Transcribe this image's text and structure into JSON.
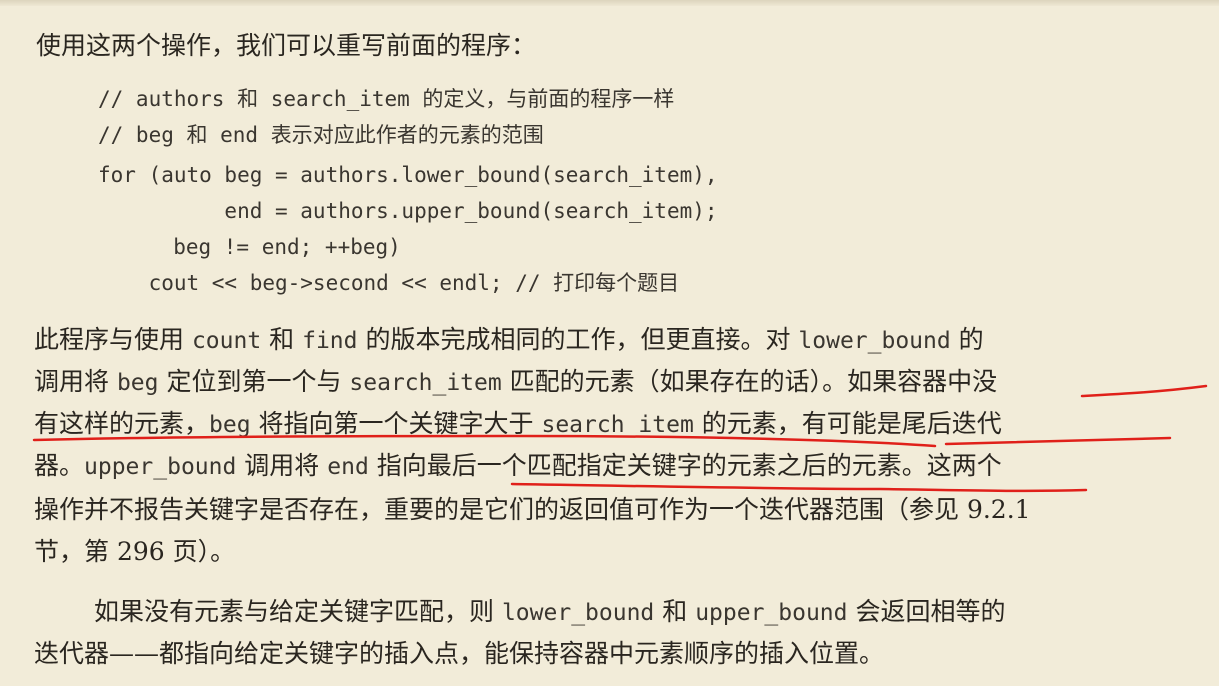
{
  "intro": "使用这两个操作，我们可以重写前面的程序：",
  "code": [
    "// authors 和 search_item 的定义，与前面的程序一样",
    "// beg 和 end 表示对应此作者的元素的范围",
    "for (auto beg = authors.lower_bound(search_item),",
    "          end = authors.upper_bound(search_item);",
    "     beg != end; ++beg)",
    "    cout << beg->second << endl; // 打印每个题目"
  ],
  "para1": {
    "l1a": "此程序与使用 ",
    "l1b": "count",
    "l1c": " 和 ",
    "l1d": "find",
    "l1e": " 的版本完成相同的工作，但更直接。对 ",
    "l1f": "lower_bound",
    "l1g": " 的",
    "l2a": "调用将 ",
    "l2b": "beg",
    "l2c": " 定位到第一个与 ",
    "l2d": "search_item",
    "l2e": " 匹配的元素（如果存在的话）。如果容器中没",
    "l3a": "有这样的元素，",
    "l3b": "beg",
    "l3c": " 将指向第一个关键字大于 ",
    "l3d": "search_item",
    "l3e": " 的元素，有可能是尾后迭代",
    "l4a": "器。",
    "l4b": "upper_bound",
    "l4c": " 调用将 ",
    "l4d": "end",
    "l4e": " 指向最后一个匹配指定关键字的元素之后的元素。这两个",
    "l5": "操作并不报告关键字是否存在，重要的是它们的返回值可作为一个迭代器范围（参见 9.2.1",
    "l6": "节，第 296 页）。"
  },
  "para2": {
    "l1a": "如果没有元素与给定关键字匹配，则 ",
    "l1b": "lower_bound",
    "l1c": " 和 ",
    "l1d": "upper_bound",
    "l1e": " 会返回相等的",
    "l2": "迭代器——都指向给定关键字的插入点，能保持容器中元素顺序的插入位置。"
  },
  "colors": {
    "background": "#f2ecd9",
    "text": "#2a2620",
    "annotation": "#e0201a"
  }
}
